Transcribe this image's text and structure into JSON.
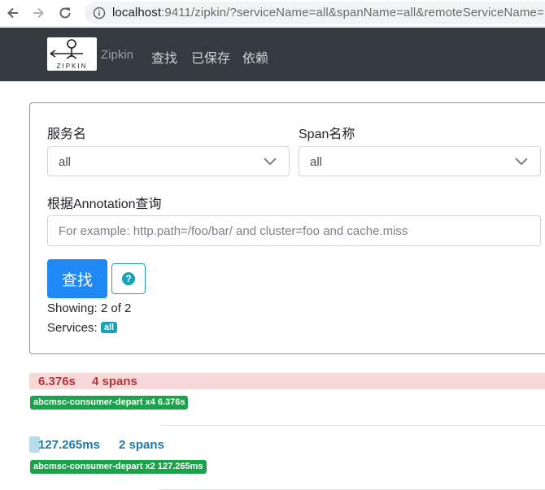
{
  "browser": {
    "url_host": "localhost",
    "url_rest": ":9411/zipkin/?serviceName=all&spanName=all&remoteServiceName="
  },
  "navbar": {
    "logo_text": "ZIPKIN",
    "brand": "Zipkin",
    "links": [
      "查找",
      "已保存",
      "依赖"
    ]
  },
  "search": {
    "service_label": "服务名",
    "service_value": "all",
    "span_label": "Span名称",
    "span_value": "all",
    "annotation_label": "根据Annotation查询",
    "annotation_placeholder": "For example: http.path=/foo/bar/ and cluster=foo and cache.miss",
    "search_button": "查找",
    "help_icon": "question-circle-icon",
    "showing": "Showing: 2 of 2",
    "services_label": "Services:",
    "services_badge": "all"
  },
  "results": [
    {
      "duration": "6.376s",
      "spans": "4 spans",
      "bar_fraction": 1.0,
      "badge": "abcmsc-consumer-depart x4 6.376s"
    },
    {
      "duration": "127.265ms",
      "spans": "2 spans",
      "bar_fraction": 0.02,
      "badge": "abcmsc-consumer-depart x2 127.265ms"
    }
  ],
  "colors": {
    "navbar": "#343a40",
    "primary": "#1e88f5",
    "info": "#17a2b8",
    "success": "#1aa34a",
    "trace_slow_bg": "#f6d8d9",
    "trace_slow_text": "#b0353c",
    "trace_fast_bg": "#b9dcec",
    "trace_fast_text": "#1f79a6"
  }
}
